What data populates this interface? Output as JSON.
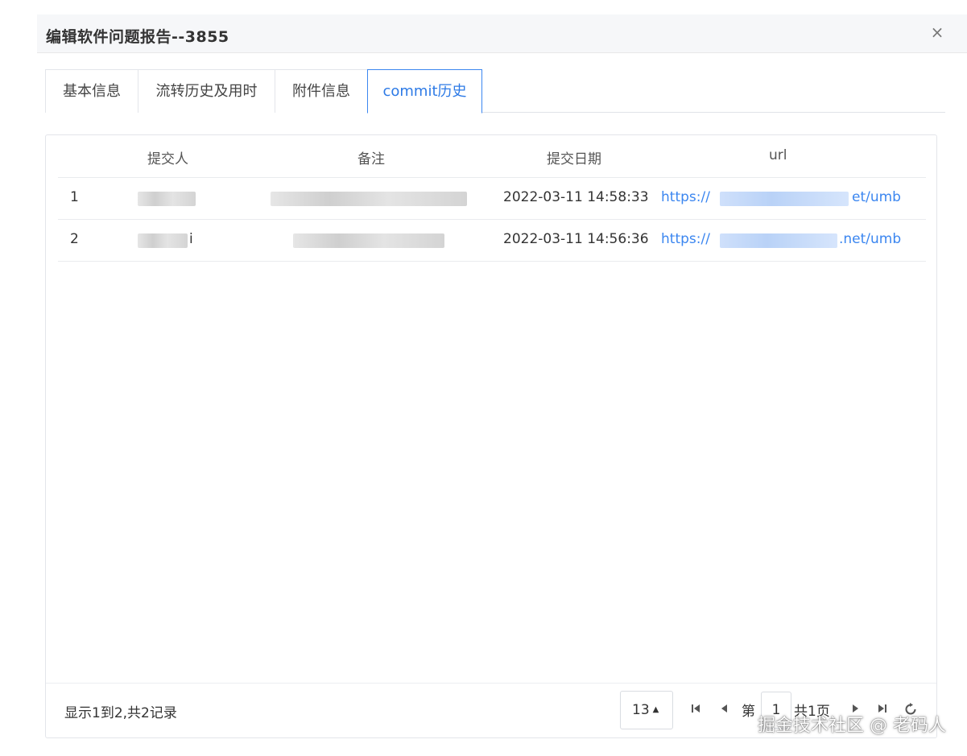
{
  "dialog": {
    "title": "编辑软件问题报告--3855",
    "close_glyph": "×"
  },
  "tabs": [
    {
      "label": "基本信息",
      "active": false
    },
    {
      "label": "流转历史及用时",
      "active": false
    },
    {
      "label": "附件信息",
      "active": false
    },
    {
      "label": "commit历史",
      "active": true
    }
  ],
  "table": {
    "columns": [
      "提交人",
      "备注",
      "提交日期",
      "url"
    ],
    "rows": [
      {
        "index": "1",
        "submitter": "",
        "note": "",
        "date": "2022-03-11 14:58:33",
        "url_start": "https://",
        "url_end": "et/umb"
      },
      {
        "index": "2",
        "submitter": "i",
        "note": "",
        "date": "2022-03-11 14:56:36",
        "url_start": "https://",
        "url_end": ".net/umb"
      }
    ]
  },
  "pagination": {
    "records_text": "显示1到2,共2记录",
    "page_size": "13",
    "page_prefix": "第",
    "current_page": "1",
    "page_suffix": "共1页"
  },
  "watermark": "掘金技术社区 @ 老码人",
  "colors": {
    "accent": "#3b86f0",
    "header_bg": "#f6f7f9",
    "border": "#e3e5ea"
  },
  "icons": [
    "close-icon",
    "caret-up-icon",
    "first-page-icon",
    "prev-page-icon",
    "next-page-icon",
    "last-page-icon",
    "refresh-icon"
  ]
}
